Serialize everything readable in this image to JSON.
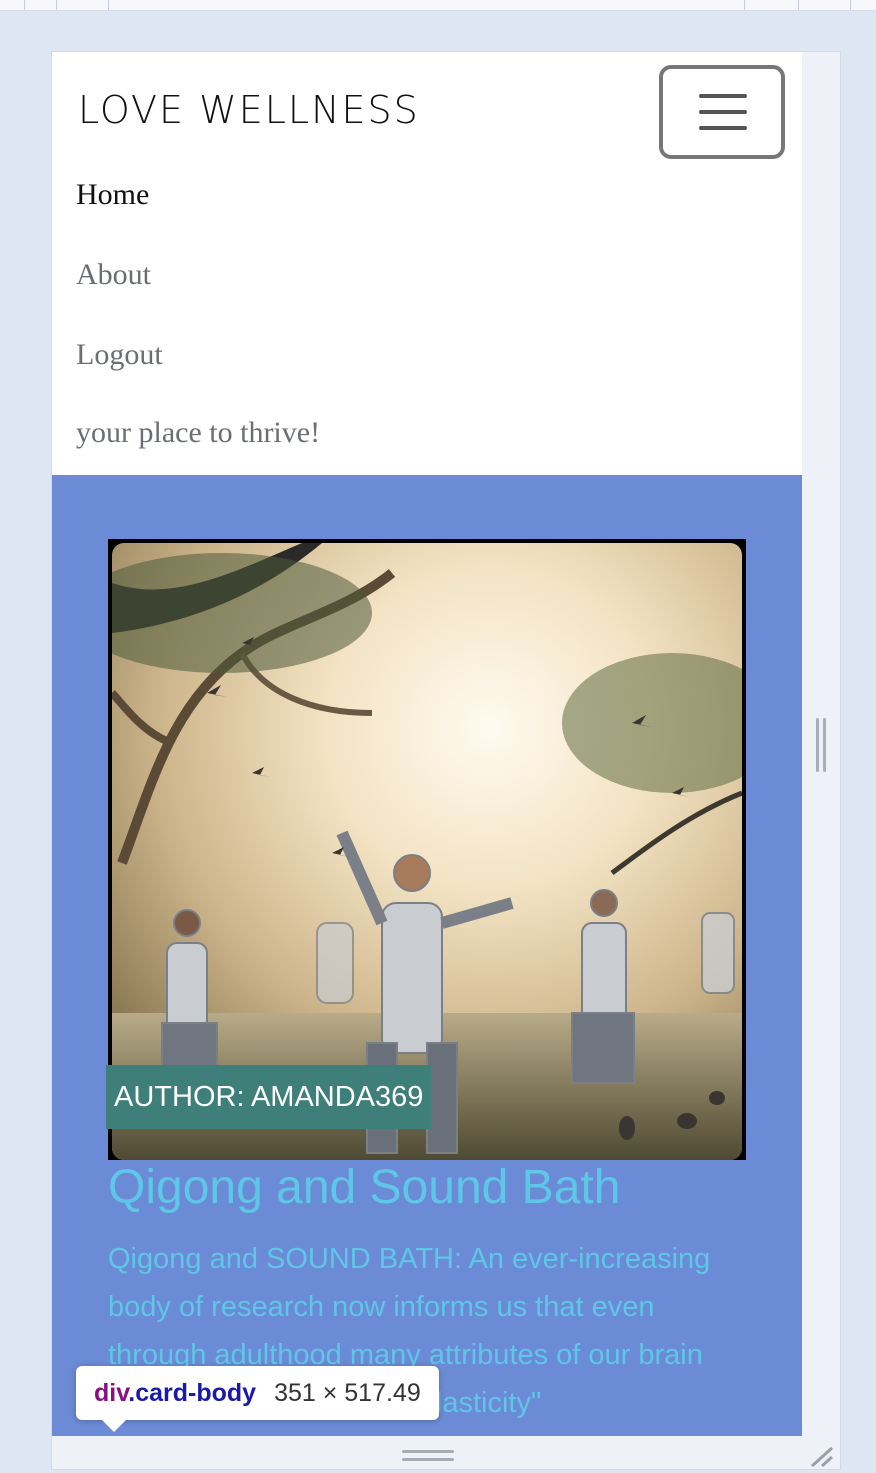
{
  "brand": {
    "name": "LOVE WELLNESS"
  },
  "nav": {
    "items": [
      {
        "label": "Home",
        "active": true
      },
      {
        "label": "About",
        "active": false
      },
      {
        "label": "Logout",
        "active": false
      }
    ],
    "tagline": "your place to thrive!"
  },
  "post": {
    "author_badge": "AUTHOR: AMANDA369",
    "title": "Qigong and Sound Bath",
    "excerpt": "Qigong and SOUND BATH: An ever-increasing body of research now informs us that even through adulthood many attributes of our brain can be changed. \"Neuroplasticity\""
  },
  "devtools": {
    "tag": "div",
    "class": ".card-body",
    "size": "351 × 517.49"
  },
  "icons": {
    "menu": "hamburger-icon",
    "resize_right": "vertical-resize-handle-icon",
    "resize_bottom": "horizontal-resize-handle-icon",
    "resize_corner": "corner-resize-icon"
  },
  "colors": {
    "page_background": "#6c8bd6",
    "title": "#5ec6e6",
    "author_badge": "#3f7f7a",
    "navbar": "#ffffff"
  }
}
